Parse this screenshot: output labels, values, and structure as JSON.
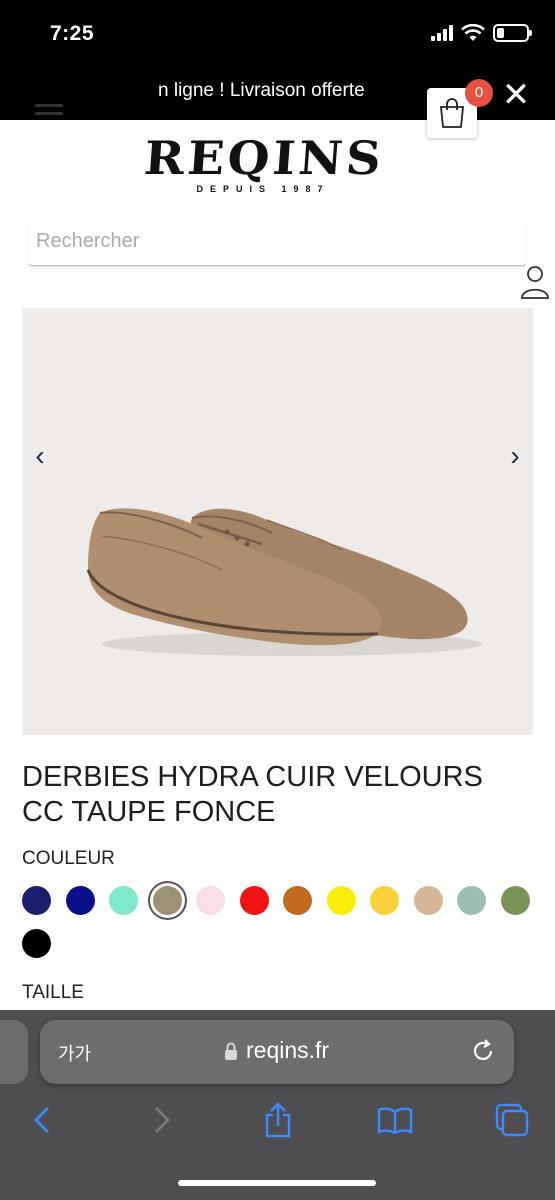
{
  "status_bar": {
    "time": "7:25"
  },
  "promo": {
    "text": "n ligne ! Livraison offerte"
  },
  "header": {
    "logo_text": "REQINS",
    "logo_subtext": "DEPUIS 1987",
    "cart_count": "0"
  },
  "search": {
    "placeholder": "Rechercher"
  },
  "carousel": {
    "prev": "‹",
    "next": "›"
  },
  "product": {
    "title": "DERBIES HYDRA CUIR VELOURS CC TAUPE FONCE",
    "color_label": "COULEUR",
    "size_label": "TAILLE",
    "swatches": [
      {
        "color": "#1a1f6e",
        "selected": false
      },
      {
        "color": "#0a0f8a",
        "selected": false
      },
      {
        "color": "#7fe8c8",
        "selected": false
      },
      {
        "color": "#9b9174",
        "selected": true
      },
      {
        "color": "#fbdde6",
        "selected": false
      },
      {
        "color": "#ef1313",
        "selected": false
      },
      {
        "color": "#c06a20",
        "selected": false
      },
      {
        "color": "#f8ee0a",
        "selected": false
      },
      {
        "color": "#f8d03a",
        "selected": false
      },
      {
        "color": "#d7b896",
        "selected": false
      },
      {
        "color": "#9ebdb5",
        "selected": false
      },
      {
        "color": "#7a9456",
        "selected": false
      },
      {
        "color": "#000000",
        "selected": false
      }
    ]
  },
  "browser": {
    "aa_label": "가가",
    "url": "reqins.fr"
  }
}
